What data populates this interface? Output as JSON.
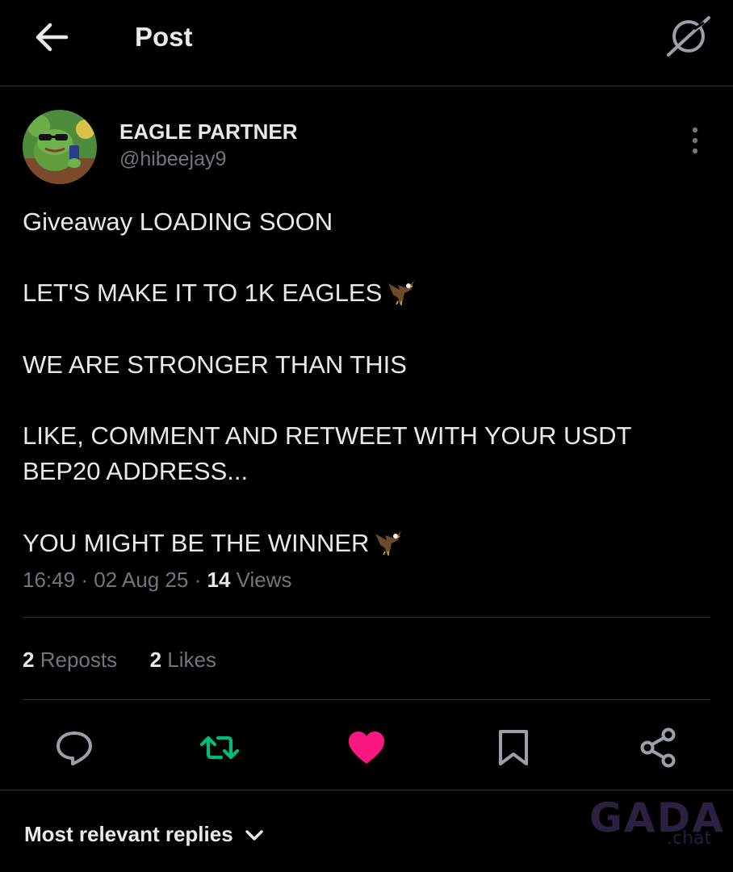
{
  "header": {
    "title": "Post",
    "back_icon": "arrow-left-icon",
    "grok_icon": "grok-icon"
  },
  "author": {
    "display_name": "EAGLE PARTNER",
    "handle": "@hibeejay9"
  },
  "tweet": {
    "line1": "Giveaway LOADING SOON",
    "line2": "LET'S MAKE IT TO 1K EAGLES",
    "line3": "WE ARE STRONGER THAN THIS",
    "line4a": "LIKE, COMMENT AND RETWEET WITH YOUR USDT",
    "line4b": "BEP20 ADDRESS...",
    "line5": "YOU MIGHT BE THE WINNER",
    "emoji_icon": "eagle-emoji-icon"
  },
  "meta": {
    "time": "16:49",
    "sep": "·",
    "date": "02 Aug 25",
    "views_count": "14",
    "views_label": "Views"
  },
  "stats": {
    "reposts_count": "2",
    "reposts_label": "Reposts",
    "likes_count": "2",
    "likes_label": "Likes"
  },
  "actions": {
    "reply_icon": "reply-icon",
    "repost_icon": "repost-icon",
    "like_icon": "heart-icon",
    "bookmark_icon": "bookmark-icon",
    "share_icon": "share-icon"
  },
  "colors": {
    "background": "#000000",
    "text": "#e7e9ea",
    "muted": "#71767b",
    "border": "#2f3336",
    "repost": "#00ba7c",
    "like": "#f91880"
  },
  "replies": {
    "label": "Most relevant replies"
  },
  "watermark": {
    "main": "GADA",
    "sub": ".chat"
  }
}
